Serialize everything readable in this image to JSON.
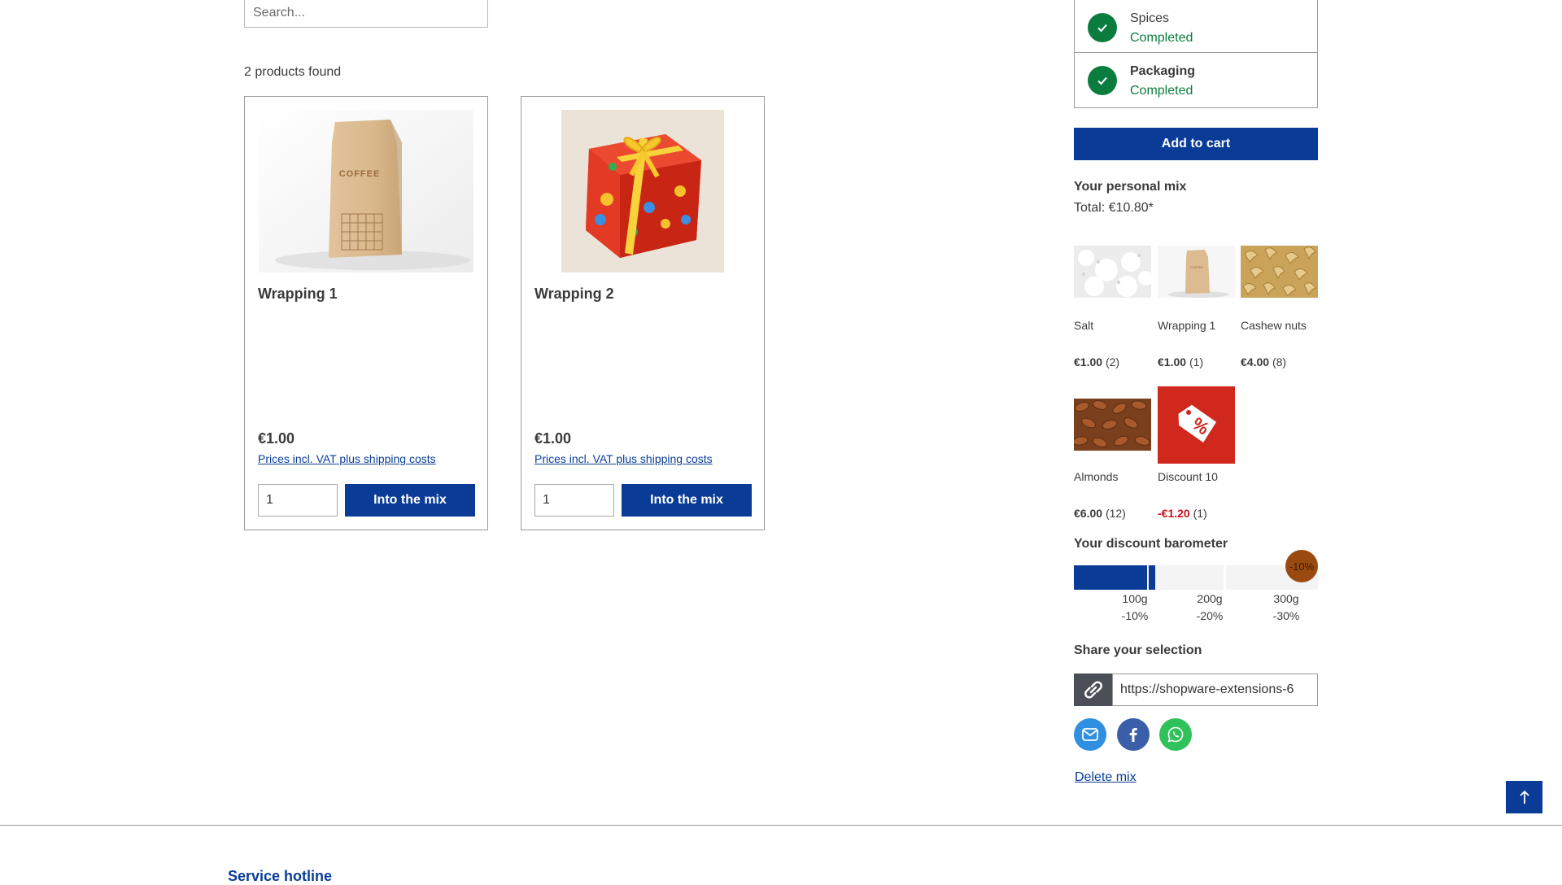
{
  "search": {
    "placeholder": "Search..."
  },
  "results": {
    "count_label": "2 products found"
  },
  "products": [
    {
      "name": "Wrapping 1",
      "price": "€1.00",
      "vat_note": "Prices incl. VAT plus shipping costs",
      "quantity": "1",
      "button_label": "Into the mix",
      "image": "coffee-bag-image"
    },
    {
      "name": "Wrapping 2",
      "price": "€1.00",
      "vat_note": "Prices incl. VAT plus shipping costs",
      "quantity": "1",
      "button_label": "Into the mix",
      "image": "gift-box-image"
    }
  ],
  "steps": [
    {
      "title": "Spices",
      "status": "Completed",
      "bold": false
    },
    {
      "title": "Packaging",
      "status": "Completed",
      "bold": true
    }
  ],
  "cart": {
    "add_label": "Add to cart"
  },
  "mix": {
    "title": "Your personal mix",
    "total": "Total: €10.80*",
    "items": [
      {
        "name": "Salt",
        "price": "€1.00",
        "qty": "(2)",
        "image": "salt-image"
      },
      {
        "name": "Wrapping 1",
        "price": "€1.00",
        "qty": "(1)",
        "image": "coffee-bag-image"
      },
      {
        "name": "Cashew nuts",
        "price": "€4.00",
        "qty": "(8)",
        "image": "cashew-image"
      },
      {
        "name": "Almonds",
        "price": "€6.00",
        "qty": "(12)",
        "image": "almond-image"
      },
      {
        "name": "Discount 10",
        "price": "-€1.20",
        "qty": "(1)",
        "image": "discount-tag-icon"
      }
    ]
  },
  "barometer": {
    "title": "Your discount barometer",
    "progress_fraction": 0.3,
    "badge": "-10%",
    "tiers": [
      {
        "weight": "100g",
        "discount": "-10%"
      },
      {
        "weight": "200g",
        "discount": "-20%"
      },
      {
        "weight": "300g",
        "discount": "-30%"
      }
    ]
  },
  "share": {
    "title": "Share your selection",
    "url": "https://shopware-extensions-6",
    "channels": [
      "email-icon",
      "facebook-icon",
      "whatsapp-icon"
    ]
  },
  "delete_label": "Delete mix",
  "footer": {
    "hotline_label": "Service hotline"
  },
  "colors": {
    "primary": "#0a3c97",
    "success": "#0a7d3e",
    "discount": "#c80f1e",
    "badge": "#9a4a10"
  }
}
